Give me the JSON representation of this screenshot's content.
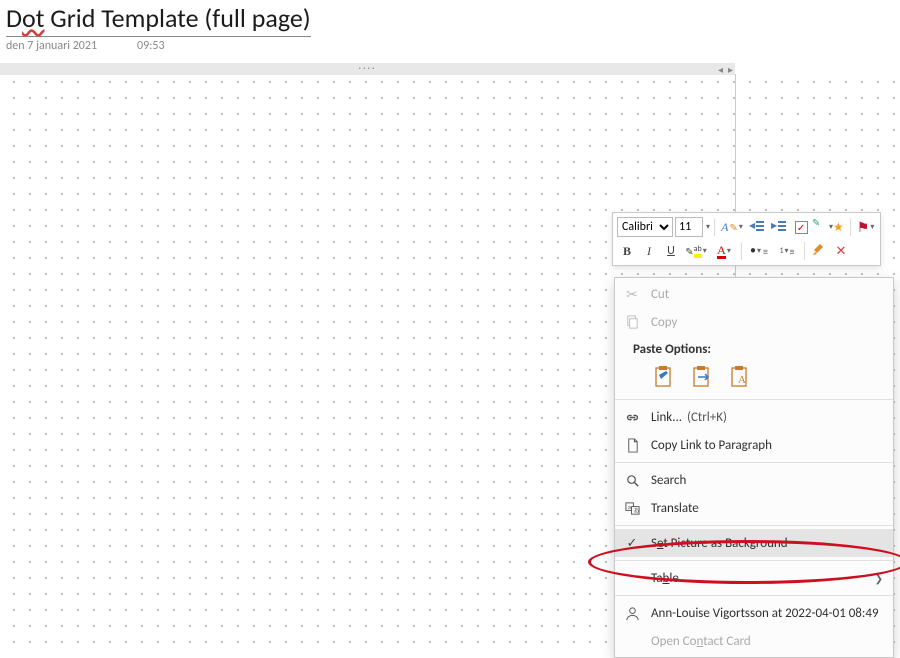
{
  "header": {
    "title_prefix": "D",
    "title_underlined": "ot",
    "title_rest": " Grid Template (full page)",
    "date": "den 7 januari 2021",
    "time": "09:53"
  },
  "toolbar": {
    "font_name": "Calibri",
    "font_size": "11",
    "styles_icon": "A",
    "bold": "B",
    "italic": "I",
    "underline": "U",
    "highlight_glyph": "ab",
    "font_color_glyph": "A"
  },
  "context_menu": {
    "cut": "Cut",
    "copy": "Copy",
    "paste_label": "Paste Options:",
    "link": "Link...",
    "link_shortcut": "(Ctrl+K)",
    "copy_link": "Copy Link to Paragraph",
    "search": "Search",
    "translate": "Translate",
    "set_bg_pre": "S",
    "set_bg_u": "e",
    "set_bg_post": "t Picture as Background",
    "table_pre": "Ta",
    "table_u": "b",
    "table_post": "le",
    "author": "Ann-Louise Vigortsson at 2022-04-01 08:49",
    "open_contact_pre": "Open Co",
    "open_contact_u": "n",
    "open_contact_post": "tact Card"
  }
}
